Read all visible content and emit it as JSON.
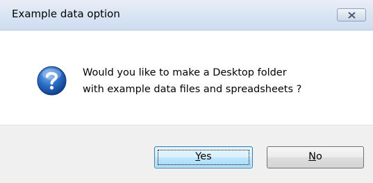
{
  "dialog": {
    "title": "Example data option",
    "message_line1": "Would you like to make a Desktop folder",
    "message_line2": "with example data files and spreadsheets ?",
    "icon": "question-icon",
    "close_icon": "close-icon"
  },
  "buttons": {
    "yes": {
      "mnemonic": "Y",
      "rest": "es"
    },
    "no": {
      "mnemonic": "N",
      "rest": "o"
    }
  },
  "colors": {
    "icon_blue": "#1f5fb8",
    "focused_button_border": "#3c7fb1"
  }
}
